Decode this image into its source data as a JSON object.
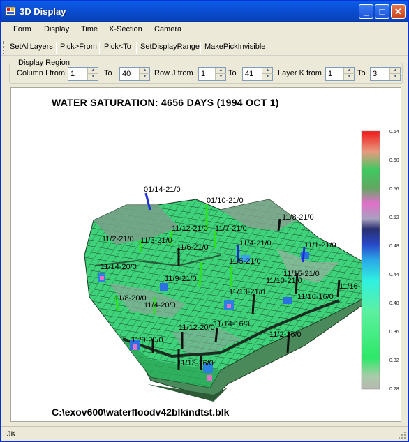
{
  "window": {
    "title": "3D Display",
    "minimize": "_",
    "maximize": "□",
    "close": "✕"
  },
  "menu": [
    "Form",
    "Display",
    "Time",
    "X-Section",
    "Camera"
  ],
  "toolbar": [
    "SetAllLayers",
    "Pick>From",
    "Pick<To",
    "SetDisplayRange",
    "MakePickInvisible"
  ],
  "region": {
    "title": "Display Region",
    "column_label": "Column I from",
    "column_from": "1",
    "to1": "To",
    "column_to": "40",
    "row_label": "Row J from",
    "row_from": "1",
    "to2": "To",
    "row_to": "41",
    "layer_label": "Layer K from",
    "layer_from": "1",
    "to3": "To",
    "layer_to": "3"
  },
  "plot": {
    "title": "WATER SATURATION: 4656 DAYS (1994 OCT 1)",
    "file": "C:\\exov600\\waterfloodv42blkindtst.blk",
    "colorbar": [
      "0.64",
      "0.60",
      "0.56",
      "0.52",
      "0.48",
      "0.44",
      "0.40",
      "0.36",
      "0.32",
      "0.28"
    ],
    "wells": [
      {
        "label": "01/14-21/0",
        "color": "#1a2ee0"
      },
      {
        "label": "01/10-21/0",
        "color": "#2ee022"
      },
      {
        "label": "11/8-21/0",
        "color": "#111111"
      },
      {
        "label": "11/12-21/0",
        "color": "#111111"
      },
      {
        "label": "11/7-21/0",
        "color": "#2ee022"
      },
      {
        "label": "11/2-21/0",
        "color": "#2ee022"
      },
      {
        "label": "11/3-21/0",
        "color": "#111111"
      },
      {
        "label": "11/6-21/0",
        "color": "#2ee022"
      },
      {
        "label": "11/1-21/0",
        "color": "#1a2ee0"
      },
      {
        "label": "11/4-21/0",
        "color": "#111111"
      },
      {
        "label": "11/5-21/0",
        "color": "#111111"
      },
      {
        "label": "11/9-21/0",
        "color": "#2ee022"
      },
      {
        "label": "11/16-",
        "color": "#111111"
      },
      {
        "label": "11/15-21/0",
        "color": "#111111"
      },
      {
        "label": "11/10-21/0",
        "color": "#111111"
      },
      {
        "label": "11/13-21/0",
        "color": "#111111"
      },
      {
        "label": "11/8-20/0",
        "color": "#2ee022"
      },
      {
        "label": "11/4-20/0",
        "color": "#111111"
      },
      {
        "label": "11/14-16/0",
        "color": "#111111"
      },
      {
        "label": "11/16-16/0",
        "color": "#111111"
      },
      {
        "label": "11/14-20/0",
        "color": "#1a2ee0"
      },
      {
        "label": "11/12-20/0",
        "color": "#111111"
      },
      {
        "label": "11/2-16/0",
        "color": "#111111"
      },
      {
        "label": "11/13-16/0",
        "color": "#1a2ee0"
      },
      {
        "label": "11/9-20/0",
        "color": "#111111"
      }
    ]
  },
  "status": {
    "text": "IJK"
  }
}
